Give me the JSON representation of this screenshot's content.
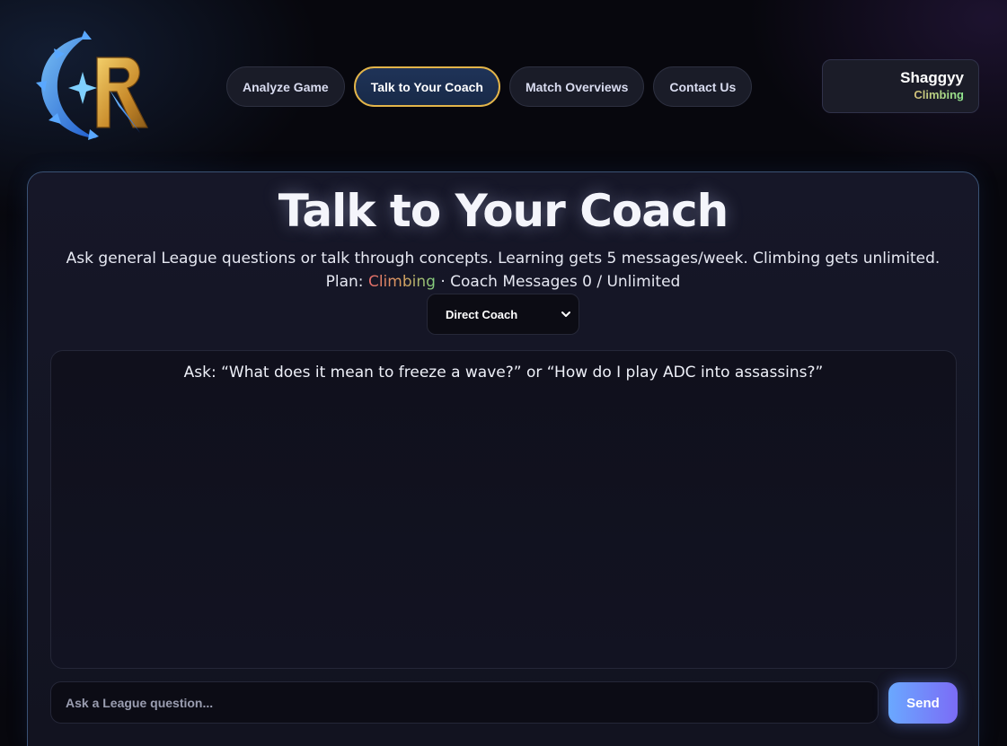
{
  "nav": {
    "items": [
      {
        "label": "Analyze Game",
        "active": false
      },
      {
        "label": "Talk to Your Coach",
        "active": true
      },
      {
        "label": "Match Overviews",
        "active": false
      },
      {
        "label": "Contact Us",
        "active": false
      }
    ]
  },
  "user": {
    "name": "Shaggyy",
    "plan": "Climbing"
  },
  "main": {
    "title": "Talk to Your Coach",
    "subtitle": "Ask general League questions or talk through concepts. Learning gets 5 messages/week. Climbing gets unlimited.",
    "plan_label": "Plan:",
    "plan_value": "Climbing",
    "usage_text": "· Coach Messages 0 / Unlimited",
    "mode_select": {
      "selected": "Direct Coach"
    },
    "chat_hint": "Ask: “What does it mean to freeze a wave?” or “How do I play ADC into assassins?”",
    "input": {
      "placeholder": "Ask a League question...",
      "value": ""
    },
    "send_label": "Send"
  },
  "colors": {
    "accent_gold": "#e3b54a",
    "send_start": "#6aa8ff",
    "send_end": "#7b6cf6",
    "panel_border": "#3a5275"
  },
  "icons": {
    "logo": "r-logo-icon",
    "select": "chevron-down-icon"
  }
}
